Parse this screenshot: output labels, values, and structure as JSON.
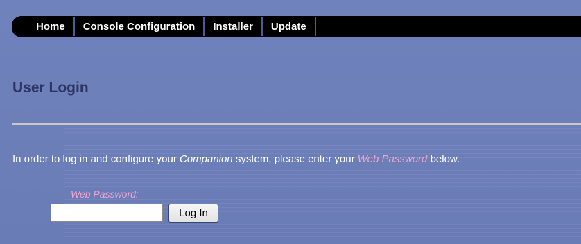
{
  "nav": {
    "items": [
      {
        "label": "Home"
      },
      {
        "label": "Console Configuration"
      },
      {
        "label": "Installer"
      },
      {
        "label": "Update"
      }
    ]
  },
  "page": {
    "title": "User Login"
  },
  "intro": {
    "part1": "In order to log in and configure your ",
    "product": "Companion",
    "part2": " system, please enter your ",
    "password_term": "Web Password",
    "part3": " below."
  },
  "login_form": {
    "password_label": "Web Password:",
    "password_value": "",
    "submit_label": "Log In"
  },
  "colors": {
    "background": "#6d7fba",
    "navbar": "#000000",
    "title": "#2c3563",
    "highlight": "#f0a4d0",
    "divider": "#c8c9c7"
  }
}
